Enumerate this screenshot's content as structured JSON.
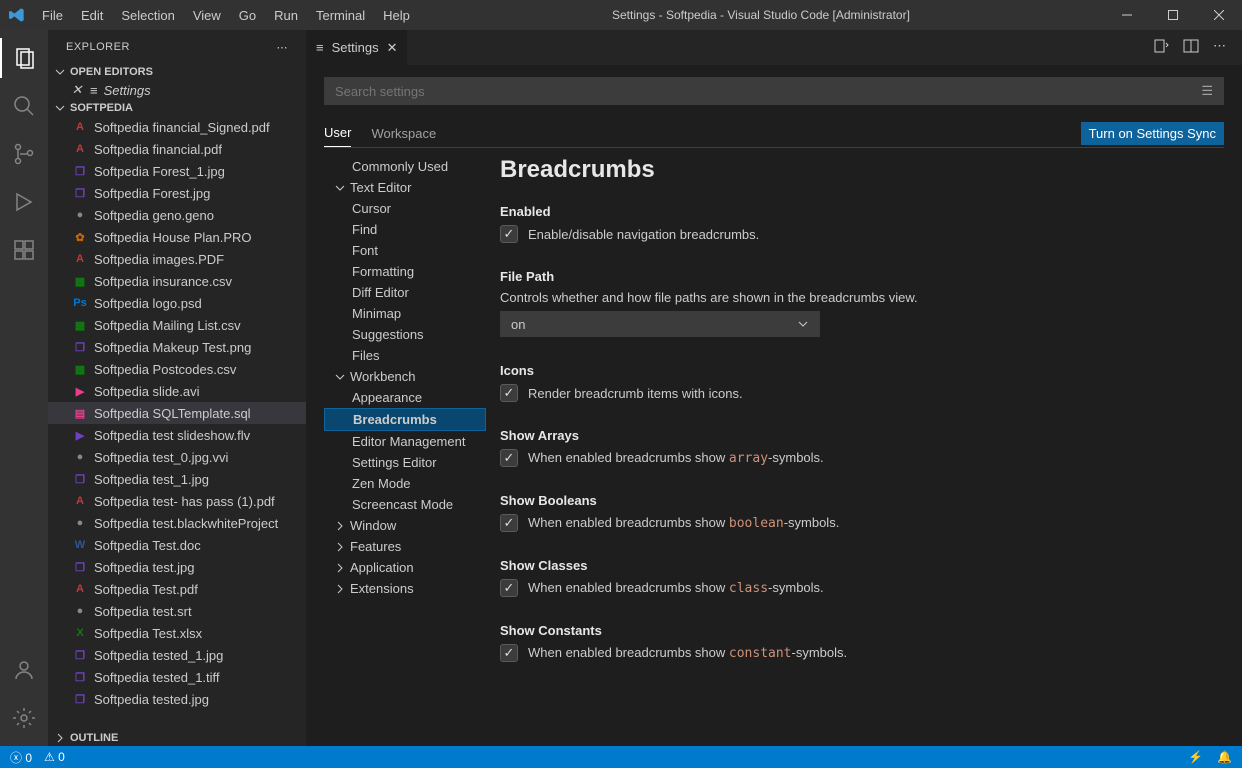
{
  "title": "Settings - Softpedia - Visual Studio Code [Administrator]",
  "menu": [
    "File",
    "Edit",
    "Selection",
    "View",
    "Go",
    "Run",
    "Terminal",
    "Help"
  ],
  "explorer": {
    "label": "EXPLORER",
    "openEditors": "OPEN EDITORS",
    "openTab": "Settings",
    "folderName": "SOFTPEDIA",
    "outline": "OUTLINE",
    "files": [
      {
        "n": "Softpedia financial_Signed.pdf",
        "c": "#c63737",
        "l": "A"
      },
      {
        "n": "Softpedia financial.pdf",
        "c": "#c63737",
        "l": "A"
      },
      {
        "n": "Softpedia Forest_1.jpg",
        "c": "#6f42c1",
        "l": "❐"
      },
      {
        "n": "Softpedia Forest.jpg",
        "c": "#6f42c1",
        "l": "❐"
      },
      {
        "n": "Softpedia geno.geno",
        "c": "#888",
        "l": "●"
      },
      {
        "n": "Softpedia House Plan.PRO",
        "c": "#cc6600",
        "l": "✿"
      },
      {
        "n": "Softpedia images.PDF",
        "c": "#c63737",
        "l": "A"
      },
      {
        "n": "Softpedia insurance.csv",
        "c": "#107c10",
        "l": "▦"
      },
      {
        "n": "Softpedia logo.psd",
        "c": "#0078d4",
        "l": "Ps"
      },
      {
        "n": "Softpedia Mailing List.csv",
        "c": "#107c10",
        "l": "▦"
      },
      {
        "n": "Softpedia Makeup Test.png",
        "c": "#6f42c1",
        "l": "❐"
      },
      {
        "n": "Softpedia Postcodes.csv",
        "c": "#107c10",
        "l": "▦"
      },
      {
        "n": "Softpedia slide.avi",
        "c": "#e83e8c",
        "l": "▶"
      },
      {
        "n": "Softpedia SQLTemplate.sql",
        "c": "#e83e8c",
        "l": "▤",
        "sel": true
      },
      {
        "n": "Softpedia test slideshow.flv",
        "c": "#6f42c1",
        "l": "▶"
      },
      {
        "n": "Softpedia test_0.jpg.vvi",
        "c": "#888",
        "l": "●"
      },
      {
        "n": "Softpedia test_1.jpg",
        "c": "#6f42c1",
        "l": "❐"
      },
      {
        "n": "Softpedia test- has pass (1).pdf",
        "c": "#c63737",
        "l": "A"
      },
      {
        "n": "Softpedia test.blackwhiteProject",
        "c": "#888",
        "l": "●"
      },
      {
        "n": "Softpedia Test.doc",
        "c": "#2b579a",
        "l": "W"
      },
      {
        "n": "Softpedia test.jpg",
        "c": "#6f42c1",
        "l": "❐"
      },
      {
        "n": "Softpedia Test.pdf",
        "c": "#c63737",
        "l": "A"
      },
      {
        "n": "Softpedia test.srt",
        "c": "#888",
        "l": "●"
      },
      {
        "n": "Softpedia Test.xlsx",
        "c": "#107c10",
        "l": "X"
      },
      {
        "n": "Softpedia tested_1.jpg",
        "c": "#6f42c1",
        "l": "❐"
      },
      {
        "n": "Softpedia tested_1.tiff",
        "c": "#6f42c1",
        "l": "❐"
      },
      {
        "n": "Softpedia tested.jpg",
        "c": "#6f42c1",
        "l": "❐"
      }
    ]
  },
  "settings": {
    "tabLabel": "Settings",
    "searchPlaceholder": "Search settings",
    "scope": {
      "user": "User",
      "workspace": "Workspace"
    },
    "sync": "Turn on Settings Sync",
    "toc": {
      "commonlyUsed": "Commonly Used",
      "textEditor": "Text Editor",
      "teChildren": [
        "Cursor",
        "Find",
        "Font",
        "Formatting",
        "Diff Editor",
        "Minimap",
        "Suggestions",
        "Files"
      ],
      "workbench": "Workbench",
      "wbChildren": [
        "Appearance",
        "Breadcrumbs",
        "Editor Management",
        "Settings Editor",
        "Zen Mode",
        "Screencast Mode"
      ],
      "window": "Window",
      "features": "Features",
      "application": "Application",
      "extensions": "Extensions"
    },
    "heading": "Breadcrumbs",
    "items": {
      "enabled": {
        "t": "Enabled",
        "d": "Enable/disable navigation breadcrumbs."
      },
      "filePath": {
        "t": "File Path",
        "d": "Controls whether and how file paths are shown in the breadcrumbs view.",
        "v": "on"
      },
      "icons": {
        "t": "Icons",
        "d": "Render breadcrumb items with icons."
      },
      "arrays": {
        "t": "Show Arrays",
        "d1": "When enabled breadcrumbs show ",
        "lit": "array",
        "d2": "-symbols."
      },
      "booleans": {
        "t": "Show Booleans",
        "d1": "When enabled breadcrumbs show ",
        "lit": "boolean",
        "d2": "-symbols."
      },
      "classes": {
        "t": "Show Classes",
        "d1": "When enabled breadcrumbs show ",
        "lit": "class",
        "d2": "-symbols."
      },
      "constants": {
        "t": "Show Constants",
        "d1": "When enabled breadcrumbs show ",
        "lit": "constant",
        "d2": "-symbols."
      }
    }
  },
  "status": {
    "errors": "0",
    "warnings": "0"
  }
}
